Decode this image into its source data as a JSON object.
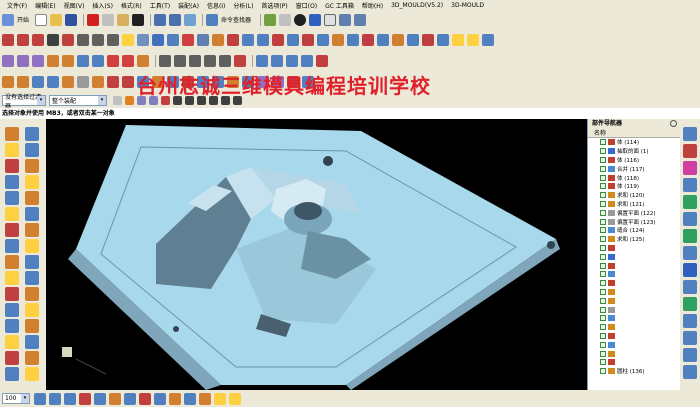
{
  "menu": [
    "文件(F)",
    "编辑(E)",
    "视图(V)",
    "插入(S)",
    "格式(R)",
    "工具(T)",
    "装配(A)",
    "信息(I)",
    "分析(L)",
    "首选项(P)",
    "窗口(O)",
    "GC 工具箱",
    "帮助(H)",
    "3D_MOULD(V5.2)",
    "3D-MOULD"
  ],
  "toolbar": {
    "start_label": "开始",
    "command_finder_label": "命令查找器"
  },
  "selection": {
    "filter_value": "没有选择过滤器",
    "scope_value": "整个装配"
  },
  "prompt": "选择对象并使用 MB3，或者双击某一对象",
  "watermark": "台州志诚三维模具编程培训学校",
  "navigator": {
    "title": "部件导航器",
    "column": "名称",
    "rows": [
      {
        "label": "体 (114)",
        "icon": "#c04030"
      },
      {
        "label": "抽取的面 (1)",
        "icon": "#3a6ad0"
      },
      {
        "label": "体 (116)",
        "icon": "#c04030"
      },
      {
        "label": "合并 (117)",
        "icon": "#4a8ad0"
      },
      {
        "label": "体 (118)",
        "icon": "#c04030"
      },
      {
        "label": "体 (119)",
        "icon": "#c04030"
      },
      {
        "label": "求和 (120)",
        "icon": "#d08a20"
      },
      {
        "label": "求和 (121)",
        "icon": "#d08a20"
      },
      {
        "label": "偏置平面 (122)",
        "icon": "#9a9a9a"
      },
      {
        "label": "偏置平面 (123)",
        "icon": "#9a9a9a"
      },
      {
        "label": "缝合 (124)",
        "icon": "#4a8ad0"
      },
      {
        "label": "求和 (125)",
        "icon": "#d08a20"
      },
      {
        "label": "",
        "icon": "#c04030"
      },
      {
        "label": "",
        "icon": "#3a6ad0"
      },
      {
        "label": "",
        "icon": "#c04030"
      },
      {
        "label": "",
        "icon": "#4a8ad0"
      },
      {
        "label": "",
        "icon": "#c04030"
      },
      {
        "label": "",
        "icon": "#d08a20"
      },
      {
        "label": "",
        "icon": "#d08a20"
      },
      {
        "label": "",
        "icon": "#9a9a9a"
      },
      {
        "label": "",
        "icon": "#4a8ad0"
      },
      {
        "label": "",
        "icon": "#d08a20"
      },
      {
        "label": "",
        "icon": "#c04030"
      },
      {
        "label": "",
        "icon": "#4a8ad0"
      },
      {
        "label": "",
        "icon": "#d08a20"
      },
      {
        "label": "",
        "icon": "#c04030"
      },
      {
        "label": "圆柱 (136)",
        "icon": "#d08a20"
      }
    ]
  },
  "bottom": {
    "zoom_value": "100"
  },
  "colors": {
    "model_top": "#a8d8ec",
    "model_side": "#6f94a8",
    "viewport_bg": "#000000",
    "watermark": "#e0202a"
  }
}
